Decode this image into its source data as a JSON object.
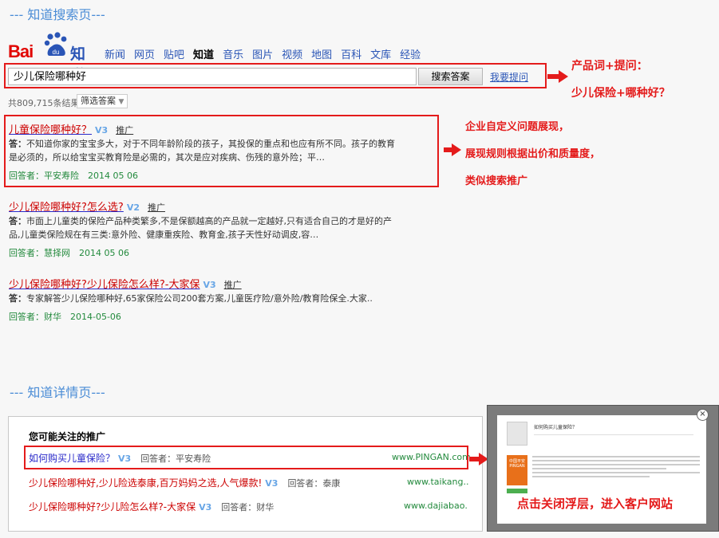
{
  "search_page": {
    "section_title": "--- 知道搜索页---",
    "logo": {
      "bai": "Bai",
      "du": "du",
      "zhidao": "知道"
    },
    "nav": [
      "新闻",
      "网页",
      "贴吧",
      "知道",
      "音乐",
      "图片",
      "视频",
      "地图",
      "百科",
      "文库",
      "经验"
    ],
    "active_nav_index": 3,
    "search": {
      "value": "少儿保险哪种好",
      "button": "搜索答案",
      "ask_link": "我要提问"
    },
    "result_count": "共809,715条结果",
    "filter": "筛选答案",
    "results": [
      {
        "title_pre": "",
        "title_hl": "儿童保险哪种好？",
        "title_post": "",
        "v": "V3",
        "promo": "推广",
        "ans_label": "答：",
        "desc_lines": [
          "不知道你家的宝宝多大，对于不同年龄阶段的孩子，其投保的重点和也应有所不同。孩子的教育",
          "是必须的，所以给宝宝买教育险是必需的，其次是应对疾病、伤残的意外险；平…"
        ],
        "meta": "回答者：平安寿险　2014 05 06"
      },
      {
        "title_pre": "",
        "title_hl": "少儿保险哪种好?怎么选?",
        "title_post": "",
        "v": "V2",
        "promo": "推广",
        "ans_label": "答：",
        "desc_lines": [
          "市面上儿童类的保险产品种类繁多,不是保额越高的产品就一定越好,只有适合自己的才是好的产",
          "品,儿童类保险规在有三类:意外险、健康重疾险、教育金,孩子天性好动调皮,容…"
        ],
        "meta": "回答者：慧择网　2014 05 06"
      },
      {
        "title_pre": "",
        "title_hl": "少儿保险哪种好?少儿保险怎么样?-大家保",
        "title_post": "",
        "v": "V3",
        "promo": "推广",
        "ans_label": "答：",
        "desc_lines": [
          "专家解答少儿保险哪种好,65家保险公司200套方案,儿童医疗险/意外险/教育险保全.大家.."
        ],
        "meta": "回答者：财华　2014-05-06"
      }
    ],
    "annotations": {
      "a1_line1": "产品词+提问：",
      "a1_line2": "少儿保险+哪种好？",
      "a2_line1": "企业自定义问题展现，",
      "a2_line2": "展现规则根据出价和质量度，",
      "a2_line3": "类似搜索推广"
    }
  },
  "detail_page": {
    "section_title": "--- 知道详情页---",
    "heading": "您可能关注的推广",
    "rows": [
      {
        "title": "如何购买儿童保险？",
        "v": "V3",
        "answerer": "回答者：平安寿险",
        "url": "www.PINGAN.com"
      },
      {
        "title": "少儿保险哪种好,少儿险选泰康,百万妈妈之选,人气爆款!",
        "v": "V3",
        "answerer": "回答者：泰康",
        "url": "www.taikang.."
      },
      {
        "title": "少儿保险哪种好?少儿险怎么样?-大家保",
        "v": "V3",
        "answerer": "回答者：财华",
        "url": "www.dajiabao."
      }
    ],
    "popup": {
      "title": "如何购买儿童保险？",
      "brand": "中国平安 PINGAN",
      "close": "×"
    },
    "annotation": "点击关闭浮层，进入客户网站"
  },
  "colors": {
    "accent_red": "#e41b1b",
    "link_blue": "#2a55b6",
    "section_blue": "#4a8cd6",
    "green": "#238a3d"
  }
}
